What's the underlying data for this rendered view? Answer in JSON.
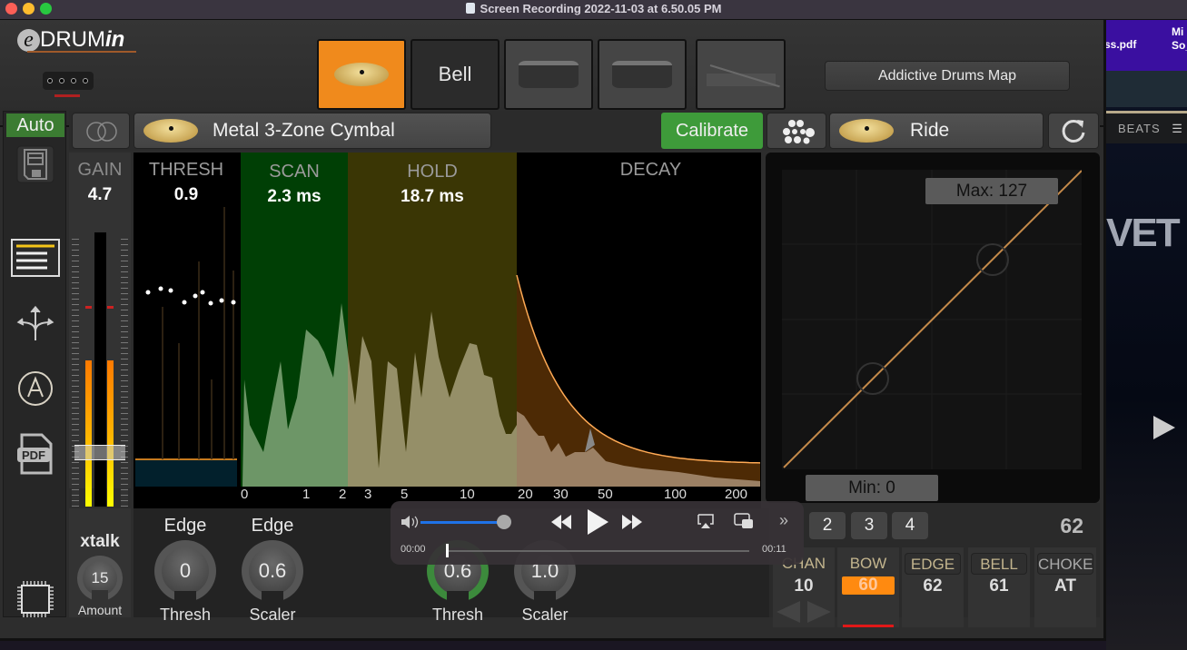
{
  "window": {
    "title": "Screen Recording 2022-11-03 at 6.50.05 PM"
  },
  "desktop": {
    "file_1": "ss.pdf",
    "file_2_line1": "Mi",
    "file_2_line2": "So_",
    "beats_label": "BEATS",
    "logo_fragment": "VET"
  },
  "header": {
    "logo_e": "e",
    "logo_drum": "DRUM",
    "logo_in": "in",
    "zones": [
      {
        "label": "",
        "icon": "cymbal-icon",
        "active": true
      },
      {
        "label": "Bell",
        "icon": "",
        "active": false
      },
      {
        "label": "",
        "icon": "snare-drum-icon",
        "active": false
      },
      {
        "label": "",
        "icon": "snare-drum-icon",
        "active": false
      },
      {
        "label": "",
        "icon": "hihat-pedal-icon",
        "active": false
      }
    ],
    "map_button": "Addictive Drums Map"
  },
  "sidebar": {
    "auto": "Auto",
    "icons": [
      "save-icon",
      "list-icon",
      "routing-icon",
      "auto-a-icon",
      "pdf-icon",
      "chip-icon"
    ]
  },
  "instrument_bar": {
    "instrument": "Metal 3-Zone Cymbal",
    "calibrate": "Calibrate",
    "target": "Ride"
  },
  "gain": {
    "label": "GAIN",
    "value": "4.7",
    "meter_level": 0.5,
    "peak_level": 0.73
  },
  "graph": {
    "thresh_label": "THRESH",
    "thresh_value": "0.9",
    "scan_label": "SCAN",
    "scan_value": "2.3 ms",
    "hold_label": "HOLD",
    "hold_value": "18.7 ms",
    "decay_label": "DECAY",
    "x_ticks": [
      "0",
      "1",
      "2",
      "3",
      "5",
      "10",
      "20",
      "30",
      "50",
      "100",
      "200"
    ],
    "colors": {
      "scan": "#003f05",
      "hold": "#3a3605",
      "decay": "#4d2a05",
      "scan_fill": "#6d9667",
      "hold_fill": "#958f68",
      "decay_fill": "#9b8064",
      "curve": "#ffaa55"
    }
  },
  "velocity_curve": {
    "max_label": "Max: 127",
    "min_label": "Min: 0",
    "min": 0,
    "max": 127,
    "curve_color": "#c48a4a"
  },
  "xtalk": {
    "title": "xtalk",
    "amount_value": "15",
    "amount_label": "Amount"
  },
  "knobs": [
    {
      "top": "Edge",
      "value": "0",
      "bottom": "Thresh"
    },
    {
      "top": "Edge",
      "value": "0.6",
      "bottom": "Scaler"
    },
    {
      "top": "",
      "value": "0.6",
      "bottom": "Thresh"
    },
    {
      "top": "",
      "value": "1.0",
      "bottom": "Scaler"
    }
  ],
  "midi": {
    "layers": [
      "2",
      "3",
      "4"
    ],
    "note": "62",
    "cells": [
      {
        "label": "CHAN",
        "value": "10"
      },
      {
        "label": "BOW",
        "value": "60"
      },
      {
        "label": "EDGE",
        "value": "62"
      },
      {
        "label": "BELL",
        "value": "61"
      },
      {
        "label": "CHOKE",
        "value": "AT"
      }
    ]
  },
  "media": {
    "current": "00:00",
    "duration": "00:11",
    "volume": 1.0,
    "progress": 0.0
  }
}
